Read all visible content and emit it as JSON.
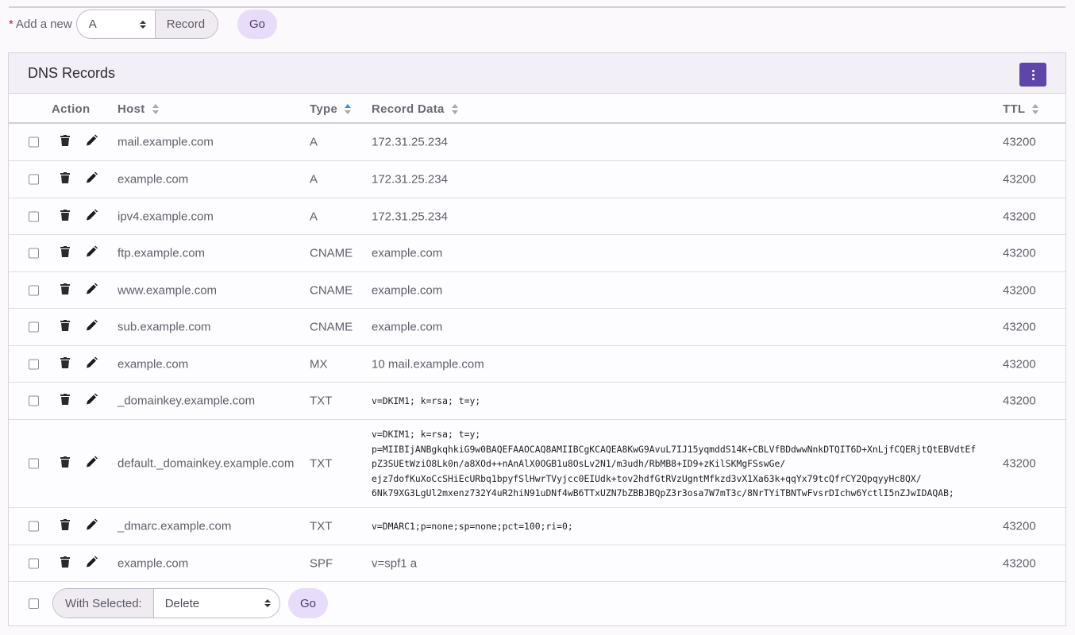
{
  "add_bar": {
    "required_mark": "*",
    "label": "Add a new",
    "type_value": "A",
    "record_label": "Record",
    "go_label": "Go"
  },
  "card": {
    "title": "DNS Records"
  },
  "table": {
    "headers": {
      "action": "Action",
      "host": "Host",
      "type": "Type",
      "data": "Record Data",
      "ttl": "TTL"
    },
    "rows": [
      {
        "host": "mail.example.com",
        "type": "A",
        "data": "172.31.25.234",
        "ttl": "43200"
      },
      {
        "host": "example.com",
        "type": "A",
        "data": "172.31.25.234",
        "ttl": "43200"
      },
      {
        "host": "ipv4.example.com",
        "type": "A",
        "data": "172.31.25.234",
        "ttl": "43200"
      },
      {
        "host": "ftp.example.com",
        "type": "CNAME",
        "data": "example.com",
        "ttl": "43200"
      },
      {
        "host": "www.example.com",
        "type": "CNAME",
        "data": "example.com",
        "ttl": "43200"
      },
      {
        "host": "sub.example.com",
        "type": "CNAME",
        "data": "example.com",
        "ttl": "43200"
      },
      {
        "host": "example.com",
        "type": "MX",
        "data": "10 mail.example.com",
        "ttl": "43200"
      },
      {
        "host": "_domainkey.example.com",
        "type": "TXT",
        "data": "v=DKIM1; k=rsa; t=y;",
        "ttl": "43200"
      },
      {
        "host": "default._domainkey.example.com",
        "type": "TXT",
        "data": "v=DKIM1; k=rsa; t=y;\np=MIIBIjANBgkqhkiG9w0BAQEFAAOCAQ8AMIIBCgKCAQEA8KwG9AvuL7IJ15yqmddS14K+CBLVfBDdwwNnkDTQIT6D+XnLjfCQERjtQtEBVdtEf\npZ3SUEtWziO8Lk0n/a8XOd++nAnAlX0OGB1u8OsLv2N1/m3udh/RbMB8+ID9+zKilSKMgFSswGe/\nejz7dofKuXoCcSHiEcURbq1bpyfSlHwrTVyjcc0EIUdk+tov2hdfGtRVzUgntMfkzd3vX1Xa63k+qqYx79tcQfrCY2QpqyyHc8QX/\n6Nk79XG3LgUl2mxenz732Y4uR2hiN91uDNf4wB6TTxUZN7bZBBJBQpZ3r3osa7W7mT3c/8NrTYiTBNTwFvsrDIchw6YctlI5nZJwIDAQAB;",
        "ttl": "43200"
      },
      {
        "host": "_dmarc.example.com",
        "type": "TXT",
        "data": "v=DMARC1;p=none;sp=none;pct=100;ri=0;",
        "ttl": "43200"
      },
      {
        "host": "example.com",
        "type": "SPF",
        "data": "v=spf1 a",
        "ttl": "43200"
      }
    ]
  },
  "footer": {
    "with_selected_label": "With Selected:",
    "action_value": "Delete",
    "go_label": "Go"
  },
  "colors": {
    "accent": "#5e45a8",
    "go_button": "#e7dcf9",
    "header_bg": "#f3eff6",
    "sort_active": "#3a8be0",
    "required": "#b4232f"
  },
  "icons": [
    "trash-icon",
    "pencil-icon",
    "kebab-menu-icon",
    "sort-icon",
    "select-arrows-icon"
  ]
}
